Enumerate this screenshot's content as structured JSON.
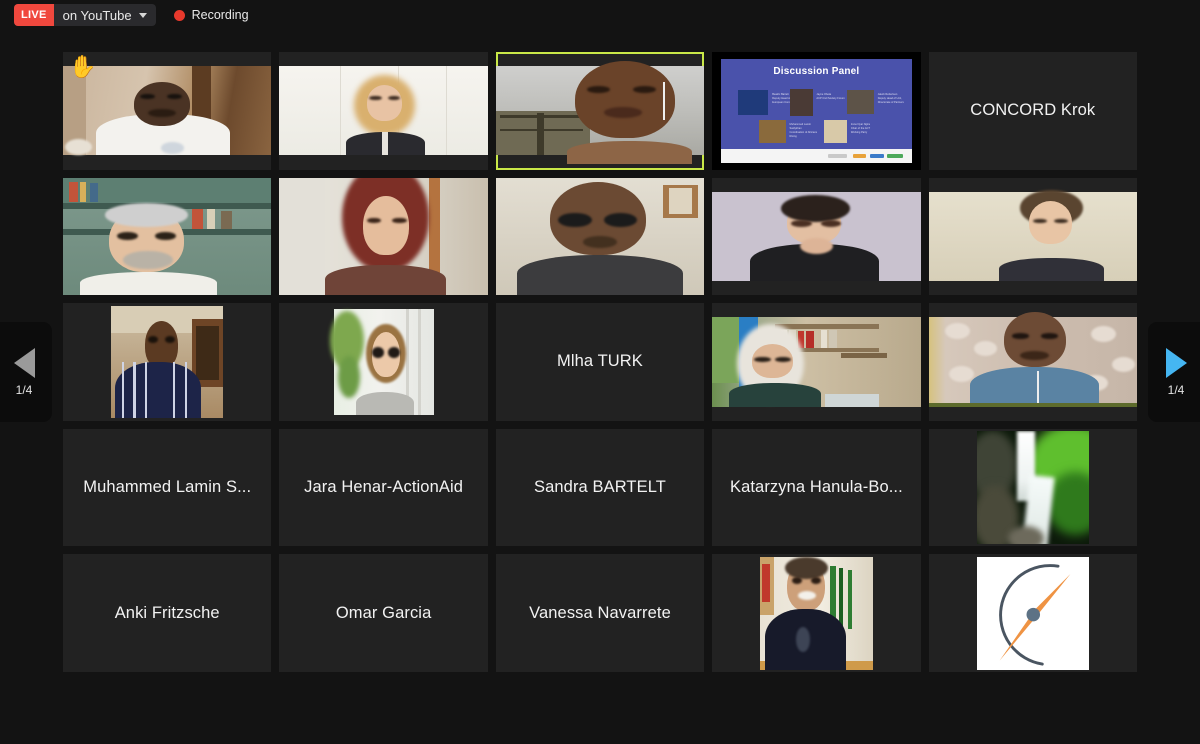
{
  "topbar": {
    "live_badge": "LIVE",
    "destination": "on YouTube",
    "dropdown_icon": "chevron-down-icon",
    "recording_label": "Recording",
    "recording_color": "#e8392c",
    "live_color": "#f0483e"
  },
  "navigation": {
    "prev": {
      "label": "1/4",
      "icon": "triangle-left-icon",
      "color": "#9a9a9a",
      "enabled": false
    },
    "next": {
      "label": "1/4",
      "icon": "triangle-right-icon",
      "color": "#45b6f2",
      "enabled": true
    }
  },
  "grid": {
    "columns": 5,
    "rows": 5,
    "active_speaker_border": "#c9e848",
    "tiles": [
      {
        "id": 1,
        "name": "",
        "type": "video",
        "hand_raised": true,
        "hand_icon": "raised-hand-icon"
      },
      {
        "id": 2,
        "name": "",
        "type": "video"
      },
      {
        "id": 3,
        "name": "",
        "type": "video",
        "active_speaker": true
      },
      {
        "id": 4,
        "name": "",
        "type": "screenshare",
        "slide": {
          "title": "Discussion Panel",
          "panelists": [
            {
              "name": "Beatrix Bartelt",
              "role": "Deputy Head of Cabinet, European Commission"
            },
            {
              "name": "Jayne Obeta",
              "role": "ACP Civil Society Forum"
            },
            {
              "name": "Jakob Rebertsen",
              "role": "Deputy Head of Unit, Directorate of Partners"
            },
            {
              "name": "Muhammed Lamin Saidykhan",
              "role": "Coordination of Africans Rising"
            },
            {
              "name": "Irene Nyar Ngira",
              "role": "Chair of the ACT Working Party"
            }
          ]
        }
      },
      {
        "id": 5,
        "name": "CONCORD Krok",
        "type": "name-only"
      },
      {
        "id": 6,
        "name": "",
        "type": "video"
      },
      {
        "id": 7,
        "name": "",
        "type": "video"
      },
      {
        "id": 8,
        "name": "",
        "type": "video"
      },
      {
        "id": 9,
        "name": "",
        "type": "video"
      },
      {
        "id": 10,
        "name": "",
        "type": "video"
      },
      {
        "id": 11,
        "name": "",
        "type": "video"
      },
      {
        "id": 12,
        "name": "",
        "type": "video"
      },
      {
        "id": 13,
        "name": "Mlha TURK",
        "type": "name-only"
      },
      {
        "id": 14,
        "name": "",
        "type": "video"
      },
      {
        "id": 15,
        "name": "",
        "type": "video"
      },
      {
        "id": 16,
        "name": "Muhammed Lamin S...",
        "type": "name-only"
      },
      {
        "id": 17,
        "name": "Jara Henar-ActionAid",
        "type": "name-only"
      },
      {
        "id": 18,
        "name": "Sandra BARTELT",
        "type": "name-only"
      },
      {
        "id": 19,
        "name": "Katarzyna Hanula-Bo...",
        "type": "name-only"
      },
      {
        "id": 20,
        "name": "",
        "type": "photo-avatar"
      },
      {
        "id": 21,
        "name": "Anki Fritzsche",
        "type": "name-only"
      },
      {
        "id": 22,
        "name": "Omar Garcia",
        "type": "name-only"
      },
      {
        "id": 23,
        "name": "Vanessa Navarrete",
        "type": "name-only"
      },
      {
        "id": 24,
        "name": "",
        "type": "video"
      },
      {
        "id": 25,
        "name": "",
        "type": "logo-avatar",
        "logo": "compass-icon"
      }
    ]
  }
}
